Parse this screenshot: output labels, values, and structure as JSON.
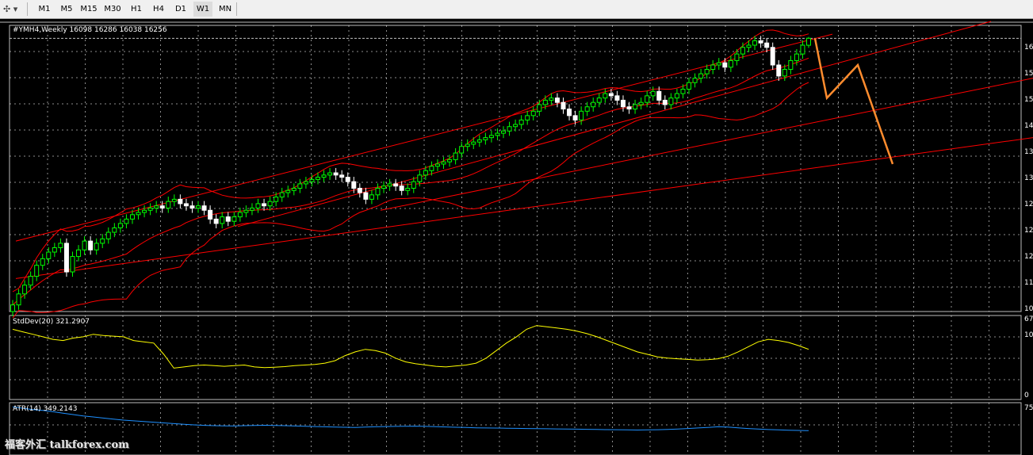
{
  "toolbar": {
    "icon": "crosshair-tools-icon",
    "timeframes": [
      "M1",
      "M5",
      "M15",
      "M30",
      "H1",
      "H4",
      "D1",
      "W1",
      "MN"
    ],
    "active": "W1"
  },
  "main_panel": {
    "title": "#YMH4,Weekly  16098 16286 16038 16256",
    "price_labels": [
      "16",
      "15",
      "15",
      "14",
      "13",
      "13",
      "12",
      "12",
      "12",
      "11",
      "10",
      "10"
    ]
  },
  "stddev_panel": {
    "title": "StdDev(20) 321.2907",
    "axis_top": "67",
    "axis_bottom": "0"
  },
  "atr_panel": {
    "title": "ATR(14) 349.2143",
    "axis_top": "75"
  },
  "watermark": "福客外汇 talkforex.com",
  "colors": {
    "bull_candle": "#00ff00",
    "bear_candle": "#ffffff",
    "bands": "#ff0000",
    "projection": "#ff8c2e",
    "stddev": "#ffff00",
    "atr": "#1e90ff",
    "grid": "#ffffff"
  },
  "chart_data": [
    {
      "type": "candlestick",
      "title": "#YMH4,Weekly",
      "last_bar": {
        "open": 16098,
        "high": 16286,
        "low": 16038,
        "close": 16256
      },
      "ylim": [
        10050,
        16550
      ],
      "bar_width_weeks": 1,
      "closes": [
        10200,
        10450,
        10650,
        10850,
        11100,
        11250,
        11400,
        11500,
        11600,
        10950,
        11300,
        11450,
        11650,
        11450,
        11600,
        11700,
        11850,
        11950,
        12050,
        12150,
        12250,
        12300,
        12350,
        12400,
        12450,
        12400,
        12550,
        12600,
        12500,
        12450,
        12400,
        12450,
        12350,
        12150,
        12050,
        12200,
        12100,
        12200,
        12300,
        12350,
        12400,
        12500,
        12450,
        12550,
        12650,
        12750,
        12800,
        12850,
        12950,
        13000,
        13050,
        13100,
        13150,
        13200,
        13150,
        13100,
        13000,
        12850,
        12750,
        12600,
        12700,
        12850,
        12900,
        12950,
        12900,
        12800,
        12850,
        13000,
        13150,
        13250,
        13350,
        13400,
        13450,
        13500,
        13650,
        13800,
        13850,
        13900,
        13950,
        14000,
        14050,
        14100,
        14150,
        14250,
        14300,
        14400,
        14500,
        14600,
        14750,
        14850,
        14900,
        14800,
        14650,
        14500,
        14400,
        14600,
        14700,
        14800,
        14900,
        15000,
        14950,
        14850,
        14700,
        14650,
        14750,
        14800,
        14950,
        15050,
        14850,
        14750,
        14900,
        15000,
        15100,
        15250,
        15350,
        15450,
        15550,
        15650,
        15700,
        15600,
        15750,
        15900,
        16050,
        16100,
        16200,
        16150,
        16050,
        15650,
        15400,
        15550,
        15750,
        15900,
        16100,
        16256
      ],
      "bollinger": {
        "upper": "upper band line",
        "middle": "middle band line",
        "lower": "lower band line"
      },
      "projection": [
        16256,
        14900,
        15650,
        13400
      ]
    },
    {
      "type": "line",
      "title": "StdDev(20)",
      "last_value": 321.2907,
      "ylim": [
        0,
        670
      ],
      "values": [
        560,
        540,
        520,
        500,
        480,
        470,
        490,
        500,
        520,
        510,
        505,
        500,
        470,
        460,
        450,
        360,
        250,
        260,
        270,
        275,
        270,
        265,
        270,
        275,
        260,
        255,
        258,
        262,
        270,
        275,
        280,
        290,
        310,
        350,
        380,
        400,
        390,
        370,
        330,
        300,
        285,
        275,
        265,
        260,
        268,
        275,
        290,
        330,
        390,
        450,
        500,
        560,
        590,
        580,
        570,
        560,
        545,
        525,
        500,
        470,
        440,
        410,
        380,
        360,
        340,
        330,
        325,
        320,
        315,
        318,
        325,
        345,
        380,
        420,
        460,
        480,
        470,
        455,
        430,
        400
      ]
    },
    {
      "type": "line",
      "title": "ATR(14)",
      "last_value": 349.2143,
      "ylim": [
        0,
        750
      ],
      "values": [
        690,
        670,
        650,
        640,
        620,
        600,
        580,
        560,
        545,
        530,
        515,
        500,
        490,
        480,
        470,
        460,
        450,
        440,
        432,
        425,
        420,
        418,
        416,
        420,
        424,
        426,
        424,
        420,
        416,
        412,
        408,
        404,
        400,
        398,
        396,
        400,
        404,
        408,
        410,
        412,
        414,
        410,
        406,
        402,
        398,
        394,
        390,
        388,
        386,
        384,
        382,
        380,
        378,
        376,
        374,
        372,
        370,
        368,
        366,
        364,
        362,
        360,
        358,
        360,
        362,
        366,
        372,
        380,
        388,
        396,
        404,
        400,
        390,
        380,
        372,
        365,
        360,
        356,
        352,
        349
      ]
    }
  ]
}
